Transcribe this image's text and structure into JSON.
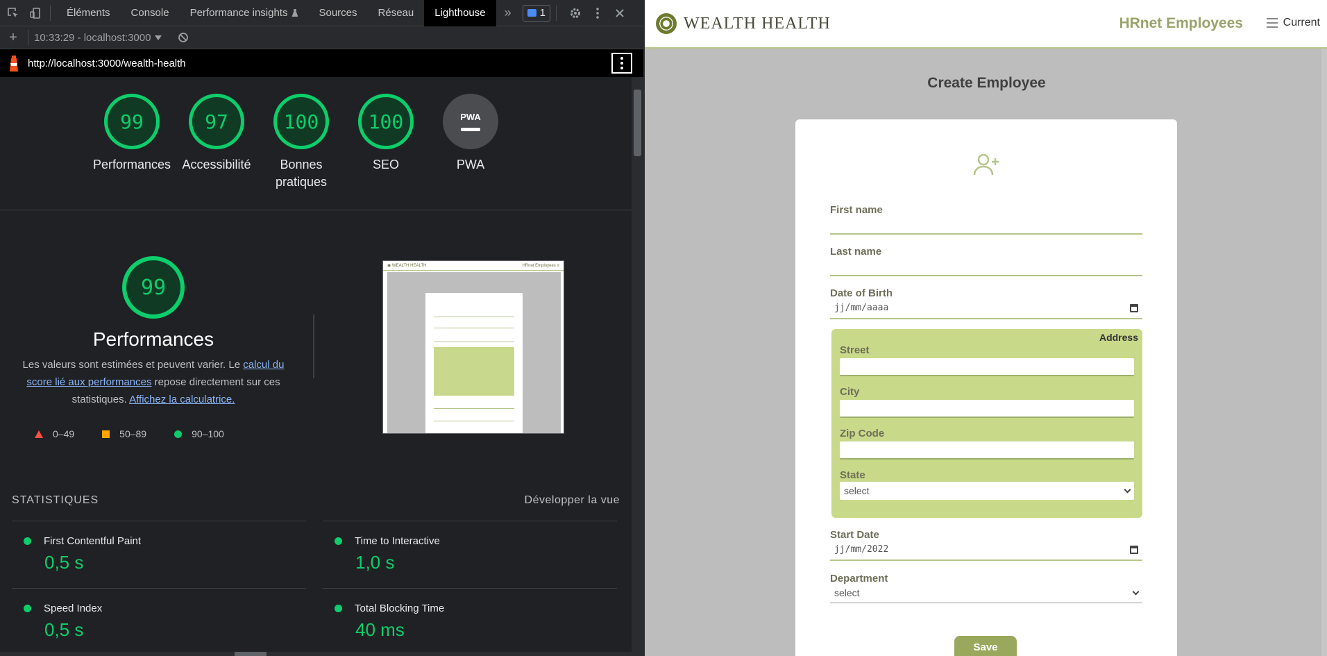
{
  "devtools": {
    "tabs": [
      {
        "label": "Éléments"
      },
      {
        "label": "Console"
      },
      {
        "label": "Performance insights"
      },
      {
        "label": "Sources"
      },
      {
        "label": "Réseau"
      },
      {
        "label": "Lighthouse"
      }
    ],
    "message_count": "1",
    "report_selector": "10:33:29 - localhost:3000",
    "url": "http://localhost:3000/wealth-health"
  },
  "lighthouse": {
    "gauges": [
      {
        "label": "Performances",
        "score": "99"
      },
      {
        "label": "Accessibilité",
        "score": "97"
      },
      {
        "label": "Bonnes pratiques",
        "score": "100"
      },
      {
        "label": "SEO",
        "score": "100"
      },
      {
        "label": "PWA",
        "score": "",
        "badge": "PWA"
      }
    ],
    "main": {
      "score": "99",
      "title": "Performances",
      "desc_before": "Les valeurs sont estimées et peuvent varier. Le ",
      "desc_link1": "calcul du score lié aux performances",
      "desc_middle": " repose directement sur ces statistiques. ",
      "desc_link2": "Affichez la calculatrice."
    },
    "legend": {
      "fail": "0–49",
      "average": "50–89",
      "pass": "90–100"
    },
    "stats": {
      "heading": "STATISTIQUES",
      "expand": "Développer la vue",
      "metrics": [
        {
          "label": "First Contentful Paint",
          "value": "0,5 s"
        },
        {
          "label": "Time to Interactive",
          "value": "1,0 s"
        },
        {
          "label": "Speed Index",
          "value": "0,5 s"
        },
        {
          "label": "Total Blocking Time",
          "value": "40 ms"
        }
      ]
    },
    "colors": {
      "pass": "#0cce6b",
      "average": "#ffa400",
      "fail": "#ff4e42"
    }
  },
  "app": {
    "brand": "WEALTH HEALTH",
    "hr_title": "HRnet Employees",
    "nav_current": "Current",
    "page_title": "Create Employee",
    "fields": {
      "first_name": "First name",
      "last_name": "Last name",
      "dob": "Date of Birth",
      "dob_placeholder": "jj/mm/aaaa",
      "address_title": "Address",
      "street": "Street",
      "city": "City",
      "zip": "Zip Code",
      "state": "State",
      "state_value": "select",
      "start_date": "Start Date",
      "start_date_value": "jj/mm/2022",
      "department": "Department",
      "department_value": "select"
    },
    "save_label": "Save",
    "colors": {
      "accent": "#9aa85e",
      "address_bg": "#c8d98a"
    }
  }
}
